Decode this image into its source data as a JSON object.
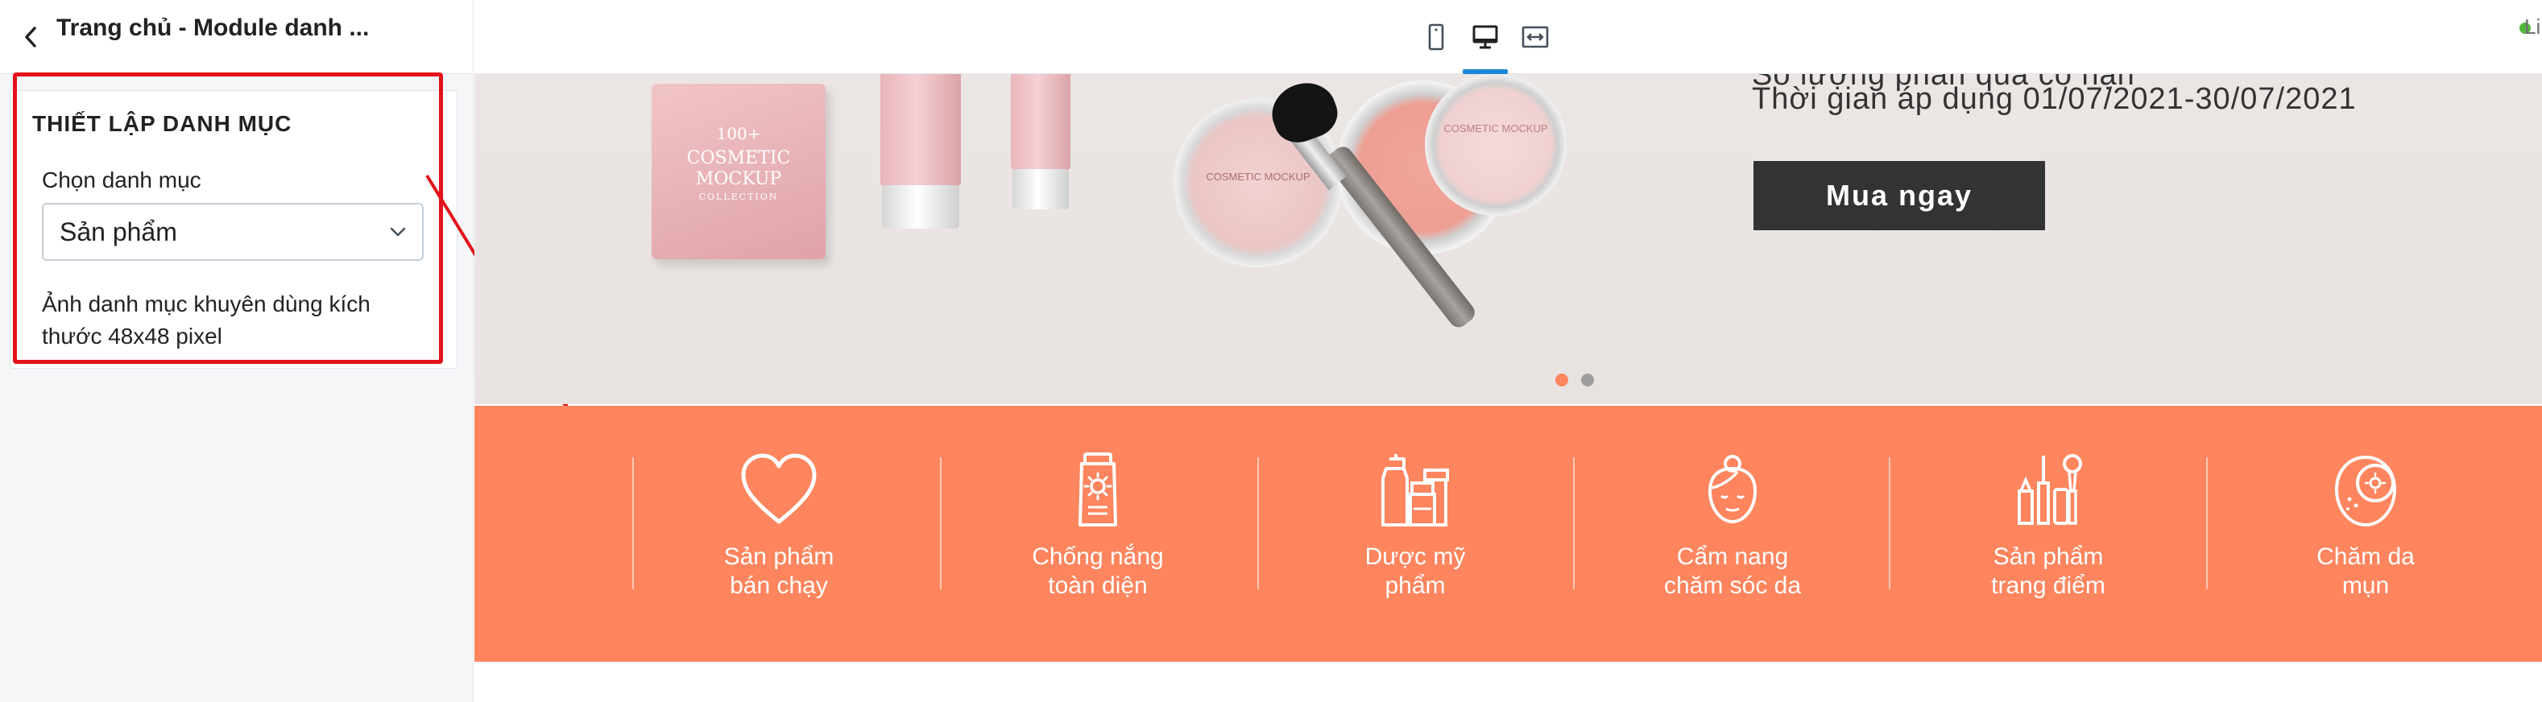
{
  "sidebar": {
    "title": "Trang chủ - Module danh ...",
    "card_heading": "THIẾT LẬP DANH MỤC",
    "select_label": "Chọn danh mục",
    "select_value": "Sản phẩm",
    "help_text": "Ảnh danh mục khuyên dùng kích thước 48x48 pixel"
  },
  "toolbar": {
    "devices": [
      "mobile-icon",
      "desktop-icon",
      "full-width-icon"
    ],
    "active_device": "desktop",
    "status_text": "Li",
    "status_color": "#50b83c"
  },
  "banner": {
    "line1": "Số lượng phần quà có hạn",
    "line2": "Thời gian áp dụng 01/07/2021-30/07/2021",
    "button_label": "Mua ngay",
    "compact_brand": "100+",
    "compact_title_1": "COSMETIC",
    "compact_title_2": "MOCKUP",
    "compact_sub": "COLLECTION",
    "jar1_title": "COSMETIC MOCKUP",
    "jar2_title": "COSMETIC MOCKUP",
    "slides": 2,
    "active_slide": 1,
    "dot_active_color": "#fe855e",
    "dot_inactive_color": "#9e9e9e"
  },
  "categories": {
    "background": "#fe855e",
    "items": [
      {
        "line1": "Sản phẩm",
        "line2": "bán chạy",
        "icon": "heart-icon"
      },
      {
        "line1": "Chống nắng",
        "line2": "toàn diện",
        "icon": "sunscreen-icon"
      },
      {
        "line1": "Dược mỹ",
        "line2": "phẩm",
        "icon": "cosmeceutical-bottles-icon"
      },
      {
        "line1": "Cẩm nang",
        "line2": "chăm sóc da",
        "icon": "face-care-icon"
      },
      {
        "line1": "Sản phẩm",
        "line2": "trang điểm",
        "icon": "makeup-tools-icon"
      },
      {
        "line1": "Chăm da",
        "line2": "mụn",
        "icon": "acne-face-icon"
      }
    ]
  },
  "annotation": {
    "color": "#e3121b"
  }
}
